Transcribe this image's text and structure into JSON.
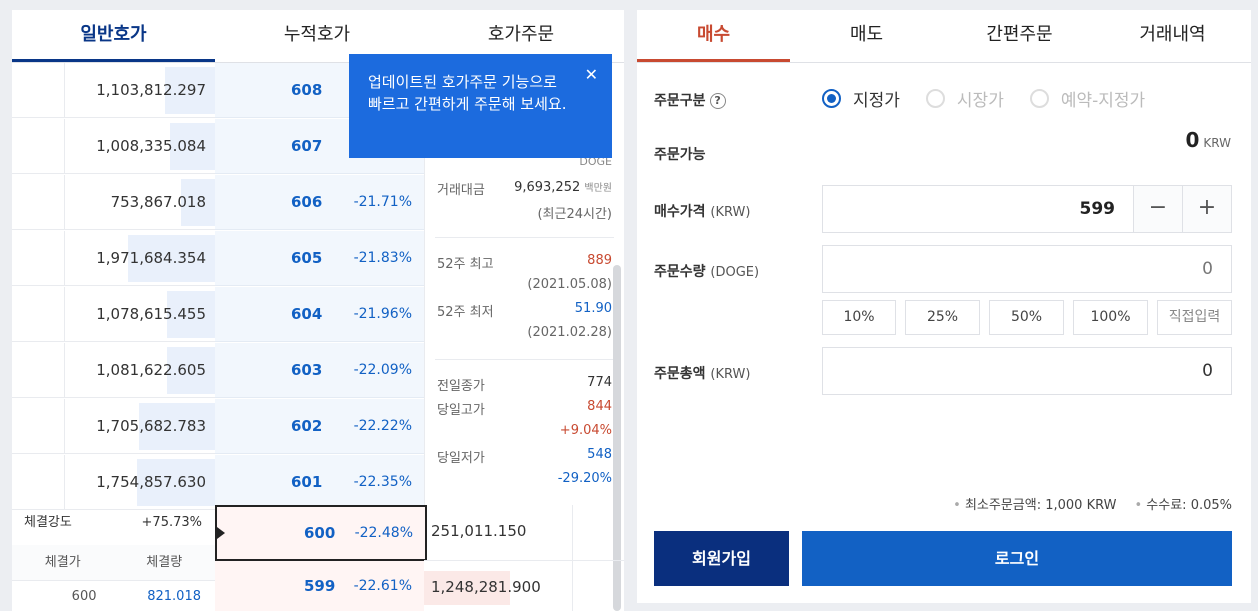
{
  "orderbook": {
    "tabs": [
      "일반호가",
      "누적호가",
      "호가주문"
    ],
    "asks": [
      {
        "volume": "1,103,812.297",
        "price": "608",
        "rate": ""
      },
      {
        "volume": "1,008,335.084",
        "price": "607",
        "rate": ""
      },
      {
        "volume": "753,867.018",
        "price": "606",
        "rate": "-21.71%"
      },
      {
        "volume": "1,971,684.354",
        "price": "605",
        "rate": "-21.83%"
      },
      {
        "volume": "1,078,615.455",
        "price": "604",
        "rate": "-21.96%"
      },
      {
        "volume": "1,081,622.605",
        "price": "603",
        "rate": "-22.09%"
      },
      {
        "volume": "1,705,682.783",
        "price": "602",
        "rate": "-22.22%"
      },
      {
        "volume": "1,754,857.630",
        "price": "601",
        "rate": "-22.35%"
      }
    ],
    "current": {
      "price": "600",
      "rate": "-22.48%",
      "bid_volume": "251,011.150"
    },
    "next_bid": {
      "price": "599",
      "rate": "-22.61%",
      "bid_volume": "1,248,281.900"
    },
    "tooltip": "업데이트된 호가주문 기능으로 빠르고 간편하게 주문해 보세요.",
    "tooltip_close": "✕",
    "info": {
      "unit": "DOGE",
      "trade_amount_label": "거래대금",
      "trade_amount_value": "9,693,252",
      "trade_amount_unit": "백만원",
      "trade_amount_period": "(최근24시간)",
      "high52_label": "52주 최고",
      "high52_value": "889",
      "high52_date": "(2021.05.08)",
      "low52_label": "52주 최저",
      "low52_value": "51.90",
      "low52_date": "(2021.02.28)",
      "prev_close_label": "전일종가",
      "prev_close_value": "774",
      "day_high_label": "당일고가",
      "day_high_value": "844",
      "day_high_rate": "+9.04%",
      "day_low_label": "당일저가",
      "day_low_value": "548",
      "day_low_rate": "-29.20%"
    },
    "strength_label": "체결강도",
    "strength_value": "+75.73%",
    "trade_head_price": "체결가",
    "trade_head_qty": "체결량",
    "last_trade_price": "600",
    "last_trade_qty": "821.018"
  },
  "order": {
    "tabs": [
      "매수",
      "매도",
      "간편주문",
      "거래내역"
    ],
    "type_label": "주문구분",
    "help": "?",
    "types": [
      "지정가",
      "시장가",
      "예약-지정가"
    ],
    "avail_label": "주문가능",
    "avail_value": "0",
    "avail_unit": "KRW",
    "price_label": "매수가격",
    "price_unit": "(KRW)",
    "price_value": "599",
    "minus": "−",
    "plus": "+",
    "qty_label": "주문수량",
    "qty_unit": "(DOGE)",
    "qty_value": "0",
    "percents": [
      "10%",
      "25%",
      "50%",
      "100%",
      "직접입력"
    ],
    "total_label": "주문총액",
    "total_unit": "(KRW)",
    "total_value": "0",
    "min_order": "최소주문금액: 1,000 KRW",
    "fee": "수수료: 0.05%",
    "join": "회원가입",
    "login": "로그인",
    "accent_buy": "#c84a31",
    "accent_blue": "#1261c4"
  }
}
